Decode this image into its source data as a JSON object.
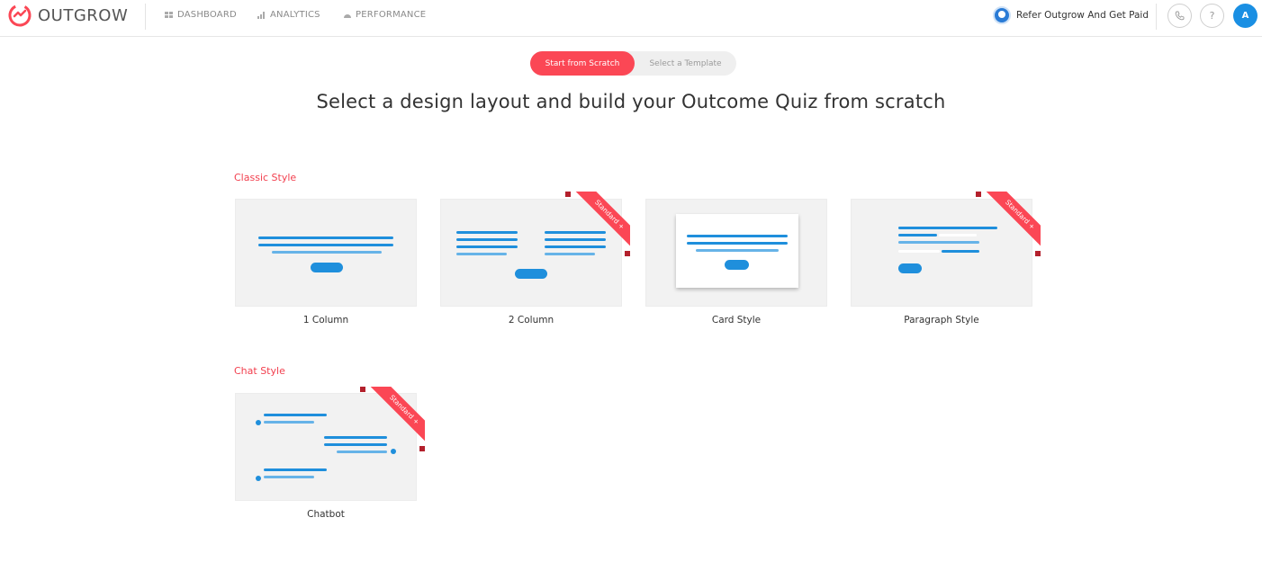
{
  "brand": {
    "name": "OUTGROW",
    "accent": "#fb4755",
    "link_blue": "#1f8fdc"
  },
  "nav": {
    "items": [
      {
        "label": "DASHBOARD",
        "icon": "grid-icon"
      },
      {
        "label": "ANALYTICS",
        "icon": "bar-chart-icon"
      },
      {
        "label": "PERFORMANCE",
        "icon": "gauge-icon"
      }
    ],
    "refer_label": "Refer Outgrow And Get Paid",
    "avatar_initial": "A"
  },
  "toggle": {
    "active": "Start from Scratch",
    "inactive": "Select a Template"
  },
  "heading": "Select a design layout and build your Outcome Quiz from scratch",
  "sections": [
    {
      "label": "Classic Style",
      "layouts": [
        {
          "name": "1 Column",
          "badge": ""
        },
        {
          "name": "2 Column",
          "badge": "Standard +"
        },
        {
          "name": "Card Style",
          "badge": ""
        },
        {
          "name": "Paragraph Style",
          "badge": "Standard +"
        }
      ]
    },
    {
      "label": "Chat Style",
      "layouts": [
        {
          "name": "Chatbot",
          "badge": "Standard +"
        }
      ]
    }
  ]
}
